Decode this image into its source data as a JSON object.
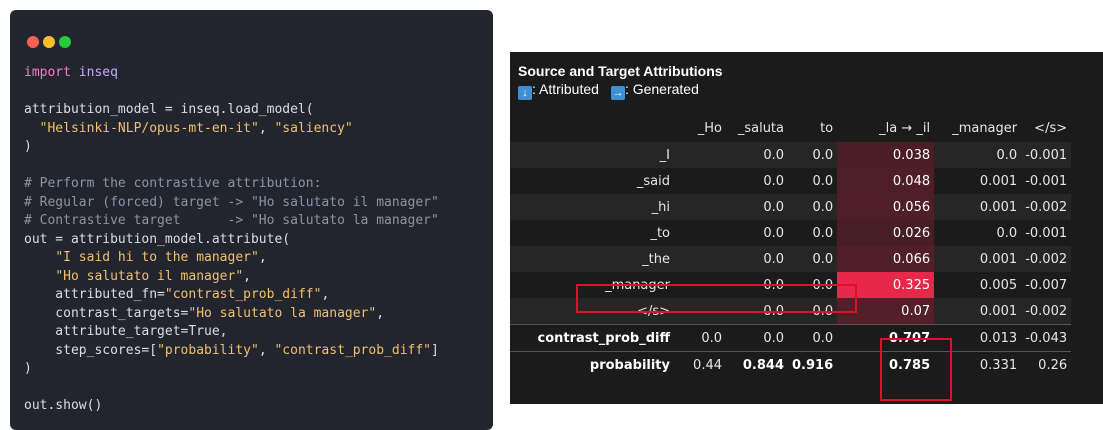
{
  "code_lines": [
    [
      {
        "t": "import ",
        "c": "kw"
      },
      {
        "t": "inseq",
        "c": "nm"
      }
    ],
    [],
    [
      {
        "t": "attribution_model = inseq.load_model(",
        "c": "plain"
      }
    ],
    [
      {
        "t": "  ",
        "c": "plain"
      },
      {
        "t": "\"Helsinki-NLP/opus-mt-en-it\"",
        "c": "str"
      },
      {
        "t": ", ",
        "c": "plain"
      },
      {
        "t": "\"saliency\"",
        "c": "str"
      }
    ],
    [
      {
        "t": ")",
        "c": "plain"
      }
    ],
    [],
    [
      {
        "t": "# Perform the contrastive attribution:",
        "c": "cmt"
      }
    ],
    [
      {
        "t": "# Regular (forced) target -> \"Ho salutato il manager\"",
        "c": "cmt"
      }
    ],
    [
      {
        "t": "# Contrastive target      -> \"Ho salutato la manager\"",
        "c": "cmt"
      }
    ],
    [
      {
        "t": "out = attribution_model.attribute(",
        "c": "plain"
      }
    ],
    [
      {
        "t": "    ",
        "c": "plain"
      },
      {
        "t": "\"I said hi to the manager\"",
        "c": "str"
      },
      {
        "t": ",",
        "c": "plain"
      }
    ],
    [
      {
        "t": "    ",
        "c": "plain"
      },
      {
        "t": "\"Ho salutato il manager\"",
        "c": "str"
      },
      {
        "t": ",",
        "c": "plain"
      }
    ],
    [
      {
        "t": "    attributed_fn=",
        "c": "plain"
      },
      {
        "t": "\"contrast_prob_diff\"",
        "c": "str"
      },
      {
        "t": ",",
        "c": "plain"
      }
    ],
    [
      {
        "t": "    contrast_targets=",
        "c": "plain"
      },
      {
        "t": "\"Ho salutato la manager\"",
        "c": "str"
      },
      {
        "t": ",",
        "c": "plain"
      }
    ],
    [
      {
        "t": "    attribute_target=True,",
        "c": "plain"
      }
    ],
    [
      {
        "t": "    step_scores=[",
        "c": "plain"
      },
      {
        "t": "\"probability\"",
        "c": "str"
      },
      {
        "t": ", ",
        "c": "plain"
      },
      {
        "t": "\"contrast_prob_diff\"",
        "c": "str"
      },
      {
        "t": "]",
        "c": "plain"
      }
    ],
    [
      {
        "t": ")",
        "c": "plain"
      }
    ],
    [],
    [
      {
        "t": "out.show()",
        "c": "plain"
      }
    ]
  ],
  "panel": {
    "title": "Source and Target Attributions",
    "legend": {
      "attributed_arrow": "↓",
      "attributed_label": ": Attributed",
      "generated_arrow": "→",
      "generated_label": ": Generated"
    },
    "columns": [
      "_Ho",
      "_saluta",
      "to",
      "_la → _il",
      "_manager",
      "</s>"
    ],
    "rows": [
      {
        "label": "_I",
        "values": [
          "",
          "0.0",
          "0.0",
          "0.038",
          "0.0",
          "-0.001"
        ],
        "heat": 0.12
      },
      {
        "label": "_said",
        "values": [
          "",
          "0.0",
          "0.0",
          "0.048",
          "0.001",
          "-0.001"
        ],
        "heat": 0.15
      },
      {
        "label": "_hi",
        "values": [
          "",
          "0.0",
          "0.0",
          "0.056",
          "0.001",
          "-0.002"
        ],
        "heat": 0.17
      },
      {
        "label": "_to",
        "values": [
          "",
          "0.0",
          "0.0",
          "0.026",
          "0.0",
          "-0.001"
        ],
        "heat": 0.08
      },
      {
        "label": "_the",
        "values": [
          "",
          "0.0",
          "0.0",
          "0.066",
          "0.001",
          "-0.002"
        ],
        "heat": 0.2
      },
      {
        "label": "_manager",
        "values": [
          "",
          "0.0",
          "0.0",
          "0.325",
          "0.005",
          "-0.007"
        ],
        "heat": 1.0
      },
      {
        "label": "</s>",
        "values": [
          "",
          "0.0",
          "0.0",
          "0.07",
          "0.001",
          "-0.002"
        ],
        "heat": 0.21
      }
    ],
    "step_scores": [
      {
        "label": "contrast_prob_diff",
        "values": [
          "0.0",
          "0.0",
          "0.0",
          "0.707",
          "0.013",
          "-0.043"
        ],
        "bold": [
          false,
          false,
          false,
          true,
          false,
          false
        ]
      },
      {
        "label": "probability",
        "values": [
          "0.44",
          "0.844",
          "0.916",
          "0.785",
          "0.331",
          "0.26"
        ],
        "bold": [
          false,
          true,
          true,
          true,
          false,
          false
        ]
      }
    ],
    "heat_color": "#e8284a"
  }
}
